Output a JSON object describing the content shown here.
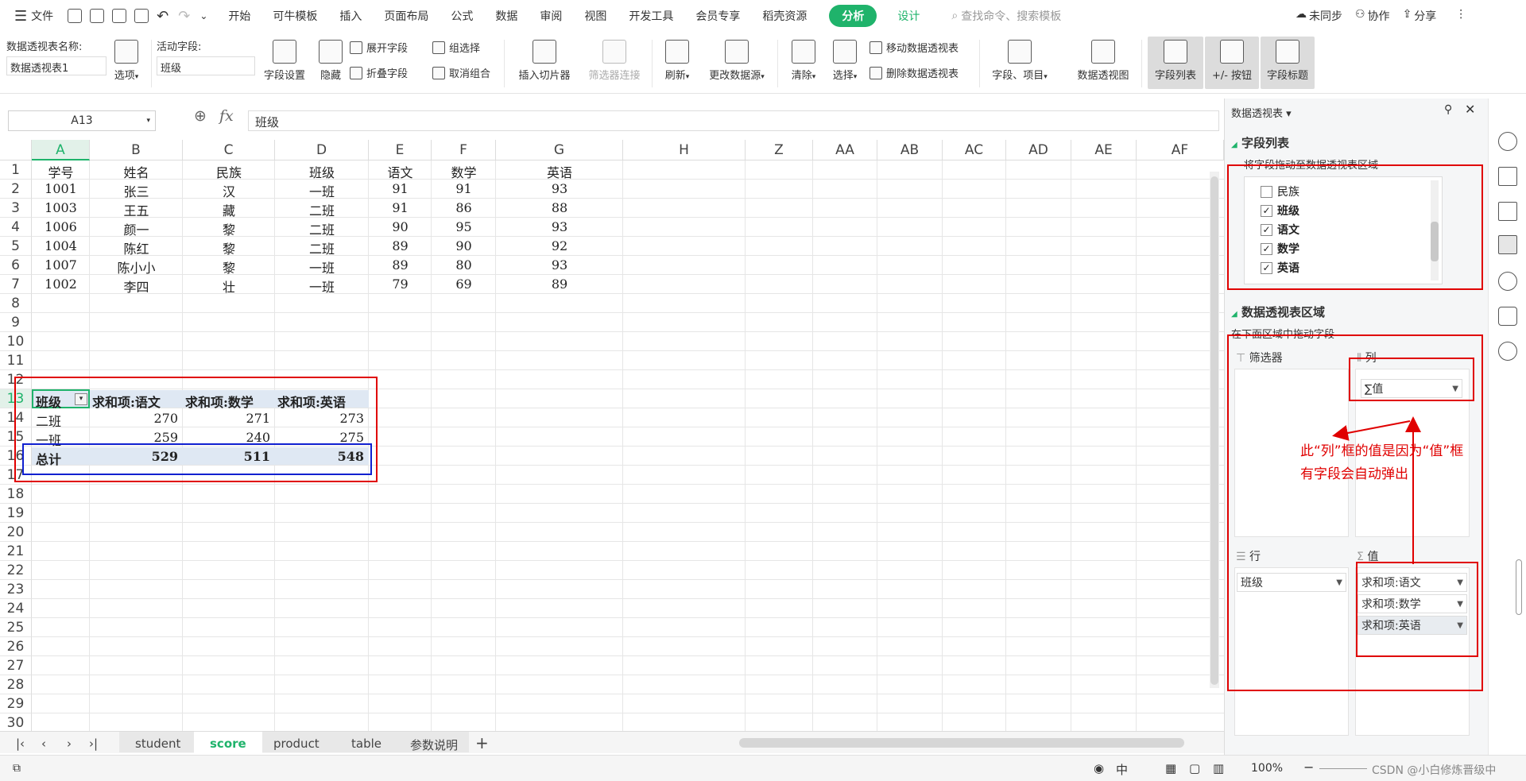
{
  "menu": {
    "file_label": "文件",
    "tabs": [
      "开始",
      "可牛模板",
      "插入",
      "页面布局",
      "公式",
      "数据",
      "审阅",
      "视图",
      "开发工具",
      "会员专享",
      "稻壳资源"
    ],
    "analysis_tab": "分析",
    "design_tab": "设计",
    "search_placeholder": "查找命令、搜索模板",
    "sync": "未同步",
    "collab": "协作",
    "share": "分享"
  },
  "ribbon": {
    "pivot_name_label": "数据透视表名称:",
    "pivot_name_value": "数据透视表1",
    "options": "选项",
    "active_field_label": "活动字段:",
    "active_field_value": "班级",
    "field_settings": "字段设置",
    "hide": "隐藏",
    "expand_field": "展开字段",
    "collapse_field": "折叠字段",
    "group_selection": "组选择",
    "ungroup": "取消组合",
    "insert_slicer": "插入切片器",
    "filter_connection": "筛选器连接",
    "refresh": "刷新",
    "change_source": "更改数据源",
    "clear": "清除",
    "select": "选择",
    "move_pivot": "移动数据透视表",
    "delete_pivot": "删除数据透视表",
    "fields_items": "字段、项目",
    "pivot_chart": "数据透视图",
    "field_list": "字段列表",
    "plus_minus": "+/- 按钮",
    "field_headers": "字段标题"
  },
  "formula": {
    "name_box": "A13",
    "fx": "fx",
    "content": "班级"
  },
  "grid": {
    "columns": [
      "A",
      "B",
      "C",
      "D",
      "E",
      "F",
      "G",
      "H",
      "Z",
      "AA",
      "AB",
      "AC",
      "AD",
      "AE",
      "AF"
    ],
    "rows": [
      "1",
      "2",
      "3",
      "4",
      "5",
      "6",
      "7",
      "8",
      "9",
      "10",
      "11",
      "12",
      "13",
      "14",
      "15",
      "16",
      "17",
      "18",
      "19",
      "20",
      "21",
      "22",
      "23",
      "24",
      "25",
      "26",
      "27",
      "28",
      "29",
      "30"
    ],
    "headers": [
      "学号",
      "姓名",
      "民族",
      "班级",
      "语文",
      "数学",
      "英语"
    ],
    "data": [
      [
        "1001",
        "张三",
        "汉",
        "一班",
        "91",
        "91",
        "93"
      ],
      [
        "1003",
        "王五",
        "藏",
        "二班",
        "91",
        "86",
        "88"
      ],
      [
        "1006",
        "颜一",
        "黎",
        "二班",
        "90",
        "95",
        "93"
      ],
      [
        "1004",
        "陈红",
        "黎",
        "二班",
        "89",
        "90",
        "92"
      ],
      [
        "1007",
        "陈小小",
        "黎",
        "一班",
        "89",
        "80",
        "93"
      ],
      [
        "1002",
        "李四",
        "壮",
        "一班",
        "79",
        "69",
        "89"
      ]
    ]
  },
  "pivot": {
    "header": [
      "班级",
      "求和项:语文",
      "求和项:数学",
      "求和项:英语"
    ],
    "rows": [
      [
        "二班",
        "270",
        "271",
        "273"
      ],
      [
        "一班",
        "259",
        "240",
        "275"
      ]
    ],
    "total": [
      "总计",
      "529",
      "511",
      "548"
    ]
  },
  "sheets": [
    "student",
    "score",
    "product",
    "table",
    "参数说明"
  ],
  "active_sheet": "score",
  "panel": {
    "title": "数据透视表",
    "field_list_title": "字段列表",
    "field_list_hint": "将字段拖动至数据透视表区域",
    "fields": [
      {
        "name": "民族",
        "checked": false
      },
      {
        "name": "班级",
        "checked": true
      },
      {
        "name": "语文",
        "checked": true
      },
      {
        "name": "数学",
        "checked": true
      },
      {
        "name": "英语",
        "checked": true
      }
    ],
    "areas_title": "数据透视表区域",
    "areas_hint": "在下面区域中拖动字段",
    "filter_label": "筛选器",
    "columns_label": "列",
    "columns_value": "∑值",
    "rows_label": "行",
    "rows_value": "班级",
    "values_label": "值",
    "values_items": [
      "求和项:语文",
      "求和项:数学",
      "求和项:英语"
    ]
  },
  "annotation": {
    "line1": "此“列”框的值是因为“值”框",
    "line2": "有字段会自动弹出"
  },
  "status": {
    "zoom": "100%",
    "watermark": "CSDN @小白修炼晋级中"
  },
  "colors": {
    "accent": "#1fb36b",
    "annotation_red": "#e00000",
    "annotation_blue": "#1020d0"
  }
}
